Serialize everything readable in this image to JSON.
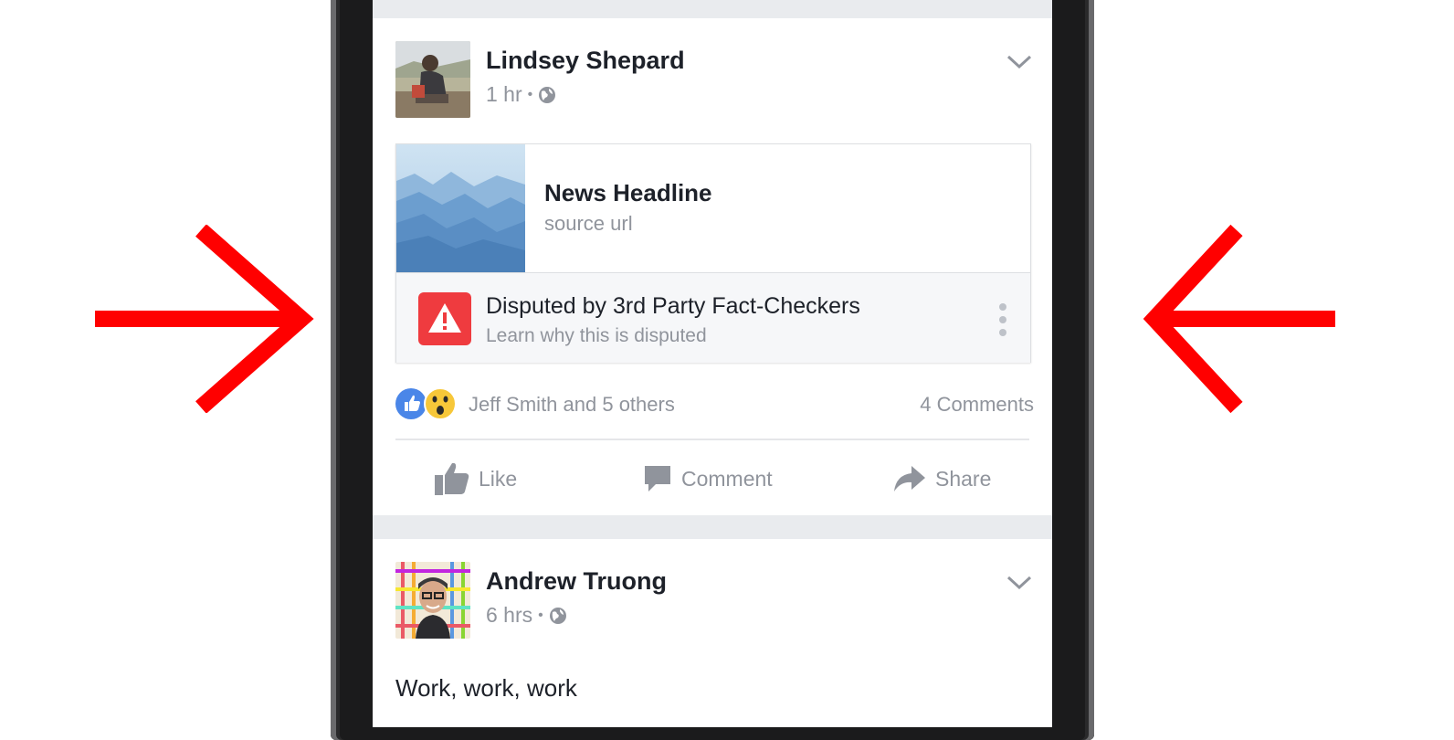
{
  "posts": [
    {
      "author": "Lindsey Shepard",
      "time": "1 hr",
      "separator": "•",
      "link": {
        "headline": "News Headline",
        "source": "source url"
      },
      "dispute": {
        "title": "Disputed by 3rd Party Fact-Checkers",
        "subtitle": "Learn why this is disputed"
      },
      "reactions_text": "Jeff Smith and 5 others",
      "comments_count": "4 Comments",
      "actions": {
        "like": "Like",
        "comment": "Comment",
        "share": "Share"
      }
    },
    {
      "author": "Andrew Truong",
      "time": "6 hrs",
      "separator": "•",
      "text": "Work, work, work"
    }
  ],
  "colors": {
    "annotation_arrow": "#ff0000",
    "warning": "#ef3b3f",
    "like_blue": "#4267b2",
    "wow_yellow": "#f7c739"
  },
  "icons": [
    "arrow-right-icon",
    "arrow-left-icon",
    "globe-icon",
    "chevron-down-icon",
    "warning-icon",
    "more-vertical-icon",
    "like-reaction-icon",
    "wow-reaction-icon",
    "thumbs-up-icon",
    "comment-icon",
    "share-icon"
  ]
}
